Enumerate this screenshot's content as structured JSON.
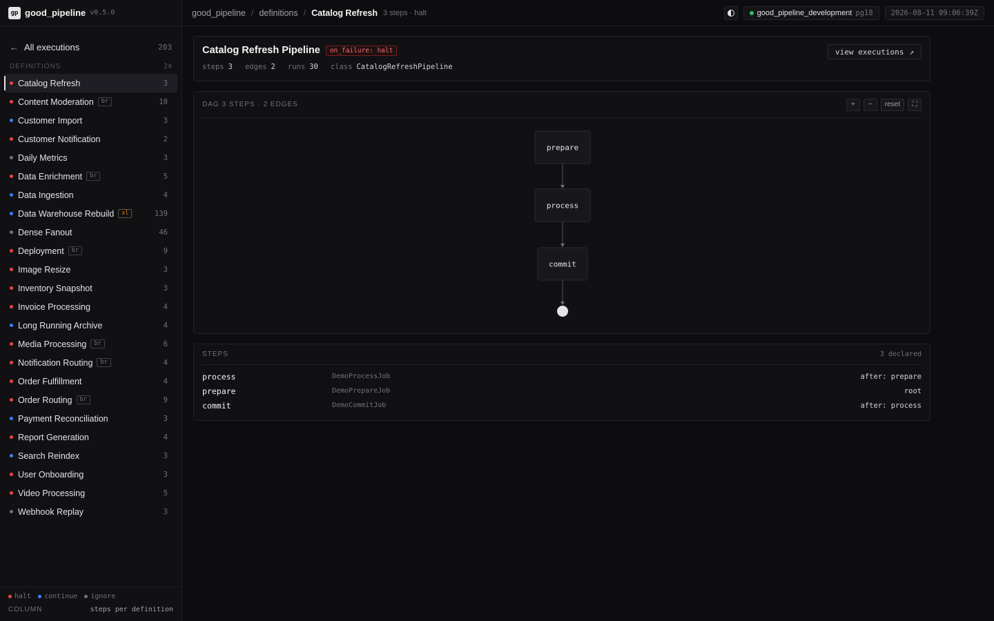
{
  "brand": {
    "logo": "gp",
    "name": "good_pipeline",
    "version": "v0.5.0"
  },
  "sidebar": {
    "all_executions": {
      "arrow": "←",
      "label": "All executions",
      "count": "203"
    },
    "definitions_header": {
      "label": "DEFINITIONS",
      "count": "24"
    },
    "items": [
      {
        "name": "Catalog Refresh",
        "count": "3",
        "tag": "",
        "policy": "halt",
        "active": true
      },
      {
        "name": "Content Moderation",
        "count": "10",
        "tag": "br",
        "policy": "halt"
      },
      {
        "name": "Customer Import",
        "count": "3",
        "tag": "",
        "policy": "continue"
      },
      {
        "name": "Customer Notification",
        "count": "2",
        "tag": "",
        "policy": "halt"
      },
      {
        "name": "Daily Metrics",
        "count": "3",
        "tag": "",
        "policy": "ignore"
      },
      {
        "name": "Data Enrichment",
        "count": "5",
        "tag": "br",
        "policy": "halt"
      },
      {
        "name": "Data Ingestion",
        "count": "4",
        "tag": "",
        "policy": "continue"
      },
      {
        "name": "Data Warehouse Rebuild",
        "count": "139",
        "tag": "xl",
        "policy": "continue"
      },
      {
        "name": "Dense Fanout",
        "count": "46",
        "tag": "",
        "policy": "ignore"
      },
      {
        "name": "Deployment",
        "count": "9",
        "tag": "br",
        "policy": "halt"
      },
      {
        "name": "Image Resize",
        "count": "3",
        "tag": "",
        "policy": "halt"
      },
      {
        "name": "Inventory Snapshot",
        "count": "3",
        "tag": "",
        "policy": "halt"
      },
      {
        "name": "Invoice Processing",
        "count": "4",
        "tag": "",
        "policy": "halt"
      },
      {
        "name": "Long Running Archive",
        "count": "4",
        "tag": "",
        "policy": "continue"
      },
      {
        "name": "Media Processing",
        "count": "6",
        "tag": "br",
        "policy": "halt"
      },
      {
        "name": "Notification Routing",
        "count": "4",
        "tag": "br",
        "policy": "halt"
      },
      {
        "name": "Order Fulfillment",
        "count": "4",
        "tag": "",
        "policy": "halt"
      },
      {
        "name": "Order Routing",
        "count": "9",
        "tag": "br",
        "policy": "halt"
      },
      {
        "name": "Payment Reconciliation",
        "count": "3",
        "tag": "",
        "policy": "continue"
      },
      {
        "name": "Report Generation",
        "count": "4",
        "tag": "",
        "policy": "halt"
      },
      {
        "name": "Search Reindex",
        "count": "3",
        "tag": "",
        "policy": "continue"
      },
      {
        "name": "User Onboarding",
        "count": "3",
        "tag": "",
        "policy": "halt"
      },
      {
        "name": "Video Processing",
        "count": "5",
        "tag": "",
        "policy": "halt"
      },
      {
        "name": "Webhook Replay",
        "count": "3",
        "tag": "",
        "policy": "ignore"
      }
    ],
    "legend": [
      {
        "label": "halt",
        "policy": "halt"
      },
      {
        "label": "continue",
        "policy": "continue"
      },
      {
        "label": "ignore",
        "policy": "ignore"
      }
    ],
    "column": {
      "label": "COLUMN",
      "value": "steps per definition"
    }
  },
  "policy_colors": {
    "halt": "#ef4444",
    "continue": "#3b82f6",
    "ignore": "#71717a"
  },
  "topbar": {
    "crumbs": [
      "good_pipeline",
      "definitions"
    ],
    "separator": "/",
    "current": "Catalog Refresh",
    "meta": "3 steps · halt",
    "env_name": "good_pipeline_development",
    "env_db": "pg18",
    "clock": "2026-08-11 09:06:39Z"
  },
  "pipeline": {
    "title": "Catalog Refresh Pipeline",
    "badge": "on_failure: halt",
    "meta": [
      {
        "label": "steps",
        "value": "3"
      },
      {
        "label": "edges",
        "value": "2"
      },
      {
        "label": "runs",
        "value": "30"
      },
      {
        "label": "class",
        "value": "CatalogRefreshPipeline"
      }
    ],
    "view_executions": "view executions",
    "view_icon": "↗"
  },
  "dag": {
    "header": "DAG 3 STEPS · 2 EDGES",
    "tools": {
      "zoom_in": "+",
      "zoom_out": "−",
      "reset": "reset",
      "fullscreen": "⛶"
    },
    "nodes": [
      "prepare",
      "process",
      "commit"
    ]
  },
  "steps": {
    "header": "STEPS",
    "declared": "3 declared",
    "rows": [
      {
        "name": "process",
        "class": "DemoProcessJob",
        "after": "after: prepare"
      },
      {
        "name": "prepare",
        "class": "DemoPrepareJob",
        "after": "root"
      },
      {
        "name": "commit",
        "class": "DemoCommitJob",
        "after": "after: process"
      }
    ]
  }
}
